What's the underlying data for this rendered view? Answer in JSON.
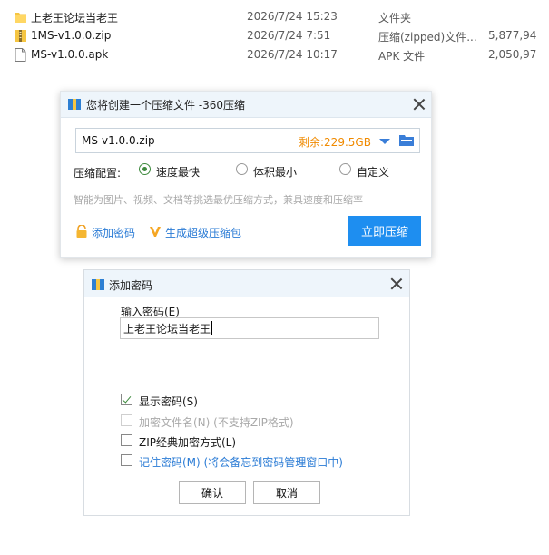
{
  "files": [
    {
      "name": "上老王论坛当老王",
      "date": "2026/7/24 15:23",
      "type": "文件夹",
      "size": "",
      "icon": "folder-icon"
    },
    {
      "name": "1MS-v1.0.0.zip",
      "date": "2026/7/24 7:51",
      "type": "压缩(zipped)文件...",
      "size": "5,877,94",
      "icon": "zip-file-icon"
    },
    {
      "name": "MS-v1.0.0.apk",
      "date": "2026/7/24 10:17",
      "type": "APK 文件",
      "size": "2,050,97",
      "icon": "file-icon"
    }
  ],
  "zip_dialog": {
    "title": "您将创建一个压缩文件 -360压缩",
    "filename": "MS-v1.0.0.zip",
    "free_space": "剩余:229.5GB",
    "config_label": "压缩配置:",
    "options": [
      "速度最快",
      "体积最小",
      "自定义"
    ],
    "selected_option": "速度最快",
    "hint": "智能为图片、视频、文档等挑选最优压缩方式，兼具速度和压缩率",
    "add_password": "添加密码",
    "super_compress": "生成超级压缩包",
    "compress_button": "立即压缩"
  },
  "password_dialog": {
    "title": "添加密码",
    "enter_label": "输入密码(E)",
    "password_value": "上老王论坛当老王",
    "checkboxes": [
      {
        "label": "显示密码(S)",
        "checked": true,
        "disabled": false
      },
      {
        "label": "加密文件名(N) (不支持ZIP格式)",
        "checked": false,
        "disabled": true
      },
      {
        "label": "ZIP经典加密方式(L)",
        "checked": false,
        "disabled": false
      },
      {
        "label": "记住密码(M) (将会备忘到密码管理窗口中)",
        "checked": false,
        "disabled": false
      }
    ],
    "ok_button": "确认",
    "cancel_button": "取消"
  },
  "colors": {
    "accent_blue": "#1e8ef0",
    "link_blue": "#2a7bd5",
    "free_space_orange": "#f08a00",
    "check_green": "#3d8a3d",
    "titlebar_bg": "#eef5fb"
  }
}
